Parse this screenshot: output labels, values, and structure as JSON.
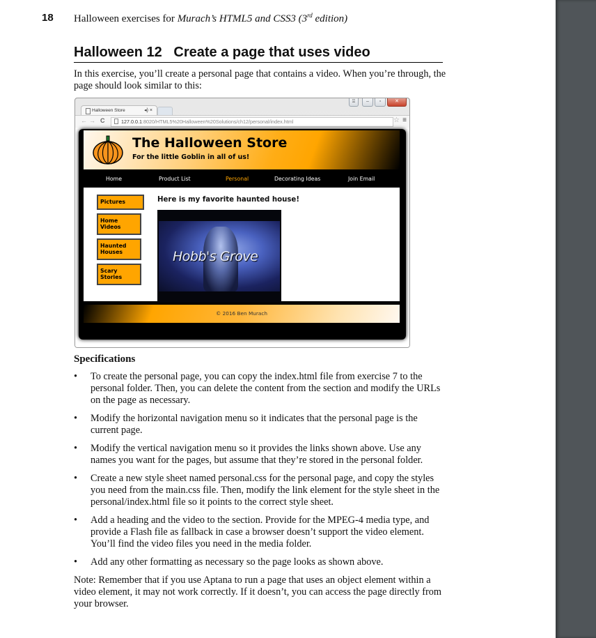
{
  "page": {
    "number": "18",
    "running_head": {
      "prefix": "Halloween exercises for ",
      "book_title": "Murach’s HTML5 and CSS3 (3",
      "superscript": "rd",
      "suffix": " edition)"
    },
    "exercise_title": "Halloween 12   Create a page that uses video",
    "intro": "In this exercise, you’ll create a personal page that contains a video. When you’re through, the page should look similar to this:"
  },
  "browser": {
    "tab_title": "Halloween Store",
    "tab_audio_icon": "speaker-icon",
    "tab_close": "×",
    "url_host": "127.0.0.1",
    "url_rest": ":8020/HTML5%20Halloween%20Solutions/ch12/personal/index.html",
    "window_controls": [
      "user-icon",
      "minimize-icon",
      "maximize-icon",
      "close-icon"
    ],
    "toolbar_icons": {
      "back": "←",
      "forward": "→",
      "reload": "C",
      "star": "☆",
      "menu": "≡"
    }
  },
  "site": {
    "title": "The Halloween Store",
    "tagline": "For the little Goblin in all of us!",
    "nav": [
      {
        "label": "Home",
        "current": false
      },
      {
        "label": "Product List",
        "current": false
      },
      {
        "label": "Personal",
        "current": true
      },
      {
        "label": "Decorating Ideas",
        "current": false
      },
      {
        "label": "Join Email",
        "current": false
      }
    ],
    "side_nav": [
      "Pictures",
      "Home Videos",
      "Haunted Houses",
      "Scary Stories"
    ],
    "section_heading": "Here is my favorite haunted house!",
    "video_caption": "Hobb's Grove",
    "footer": "© 2016 Ben Murach",
    "colors": {
      "accent": "#ffa500",
      "nav_bg": "#000000",
      "current_nav": "#ffa500"
    }
  },
  "specifications": {
    "heading": "Specifications",
    "bullet": "•",
    "items": [
      "To create the personal page, you can copy the index.html file from exercise 7 to the personal folder. Then, you can delete the content from the section and modify the URLs on the page as necessary.",
      "Modify the horizontal navigation menu so it indicates that the personal page is the current page.",
      "Modify the vertical navigation menu so it provides the links shown above. Use any names you want for the pages, but assume that they’re stored in the personal folder.",
      "Create a new style sheet named personal.css for the personal page, and copy the styles you need from the main.css file. Then, modify the link element for the style sheet in the personal/index.html file so it points to the correct style sheet.",
      "Add a heading and the video to the section. Provide for the MPEG-4 media type, and provide a Flash file as fallback in case a browser doesn’t support the video element. You’ll find the video files you need in the media folder.",
      "Add any other formatting as necessary so the page looks as shown above."
    ]
  },
  "note": "Note: Remember that if you use Aptana to run a page that uses an object element within a video element, it may not work correctly. If it doesn’t, you can access the page directly from your browser."
}
